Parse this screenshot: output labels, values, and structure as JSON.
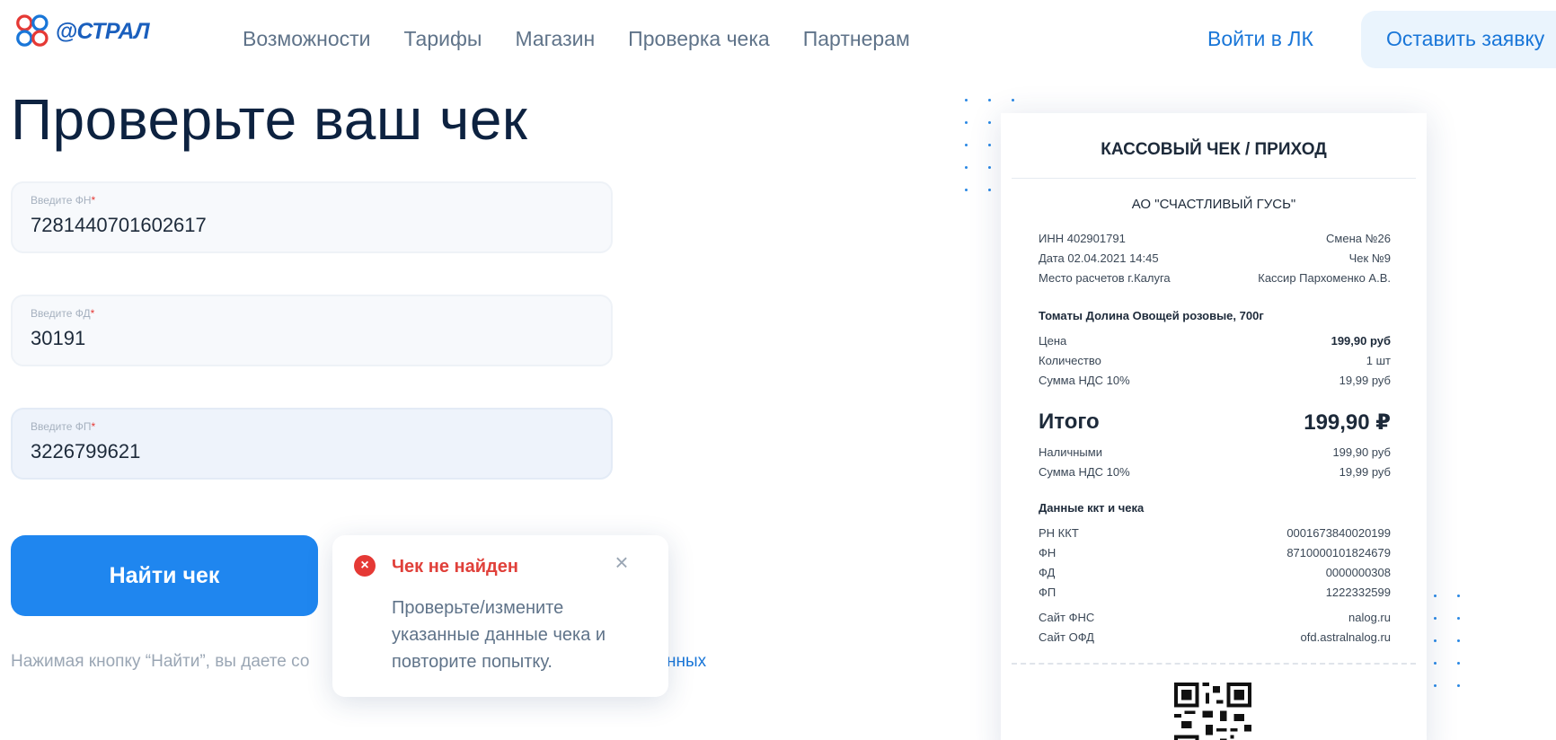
{
  "header": {
    "logo_text": "@СТРАЛ",
    "nav": [
      "Возможности",
      "Тарифы",
      "Магазин",
      "Проверка чека",
      "Партнерам"
    ],
    "login": "Войти в ЛК",
    "apply": "Оставить заявку"
  },
  "form": {
    "title": "Проверьте ваш чек",
    "fields": [
      {
        "label": "Введите ФН",
        "value": "7281440701602617"
      },
      {
        "label": "Введите ФД",
        "value": "30191"
      },
      {
        "label": "Введите ФП",
        "value": "3226799621"
      }
    ],
    "submit": "Найти чек",
    "consent_text": "Нажимая кнопку “Найти”, вы даете со",
    "consent_link": "нных"
  },
  "toast": {
    "title": "Чек не найден",
    "body": "Проверьте/измените указанные данные чека и повторите попытку."
  },
  "receipt": {
    "heading": "КАССОВЫЙ ЧЕК / ПРИХОД",
    "org": "АО \"СЧАСТЛИВЫЙ ГУСЬ\"",
    "info": [
      {
        "l": "ИНН 402901791",
        "r": "Смена №26"
      },
      {
        "l": "Дата 02.04.2021 14:45",
        "r": "Чек №9"
      },
      {
        "l": "Место расчетов г.Калуга",
        "r": "Кассир Пархоменко А.В."
      }
    ],
    "item_name": "Томаты Долина Овощей розовые, 700г",
    "item_rows": [
      {
        "l": "Цена",
        "r": "199,90 руб"
      },
      {
        "l": "Количество",
        "r": "1 шт"
      },
      {
        "l": "Сумма НДС 10%",
        "r": "19,99 руб"
      }
    ],
    "total_label": "Итого",
    "total_value": "199,90 ₽",
    "pay_rows": [
      {
        "l": "Наличными",
        "r": "199,90 руб"
      },
      {
        "l": "Сумма НДС 10%",
        "r": "19,99 руб"
      }
    ],
    "kkt_title": "Данные ккт и чека",
    "kkt_rows": [
      {
        "l": "РН ККТ",
        "r": "0001673840020199"
      },
      {
        "l": "ФН",
        "r": "8710000101824679"
      },
      {
        "l": "ФД",
        "r": "0000000308"
      },
      {
        "l": "ФП",
        "r": "1222332599"
      }
    ],
    "site_rows": [
      {
        "l": "Сайт ФНС",
        "r": "nalog.ru"
      },
      {
        "l": "Сайт ОФД",
        "r": "ofd.astralnalog.ru"
      }
    ]
  },
  "colors": {
    "accent": "#1f86ef",
    "error": "#e53935",
    "heading": "#0d2240"
  }
}
